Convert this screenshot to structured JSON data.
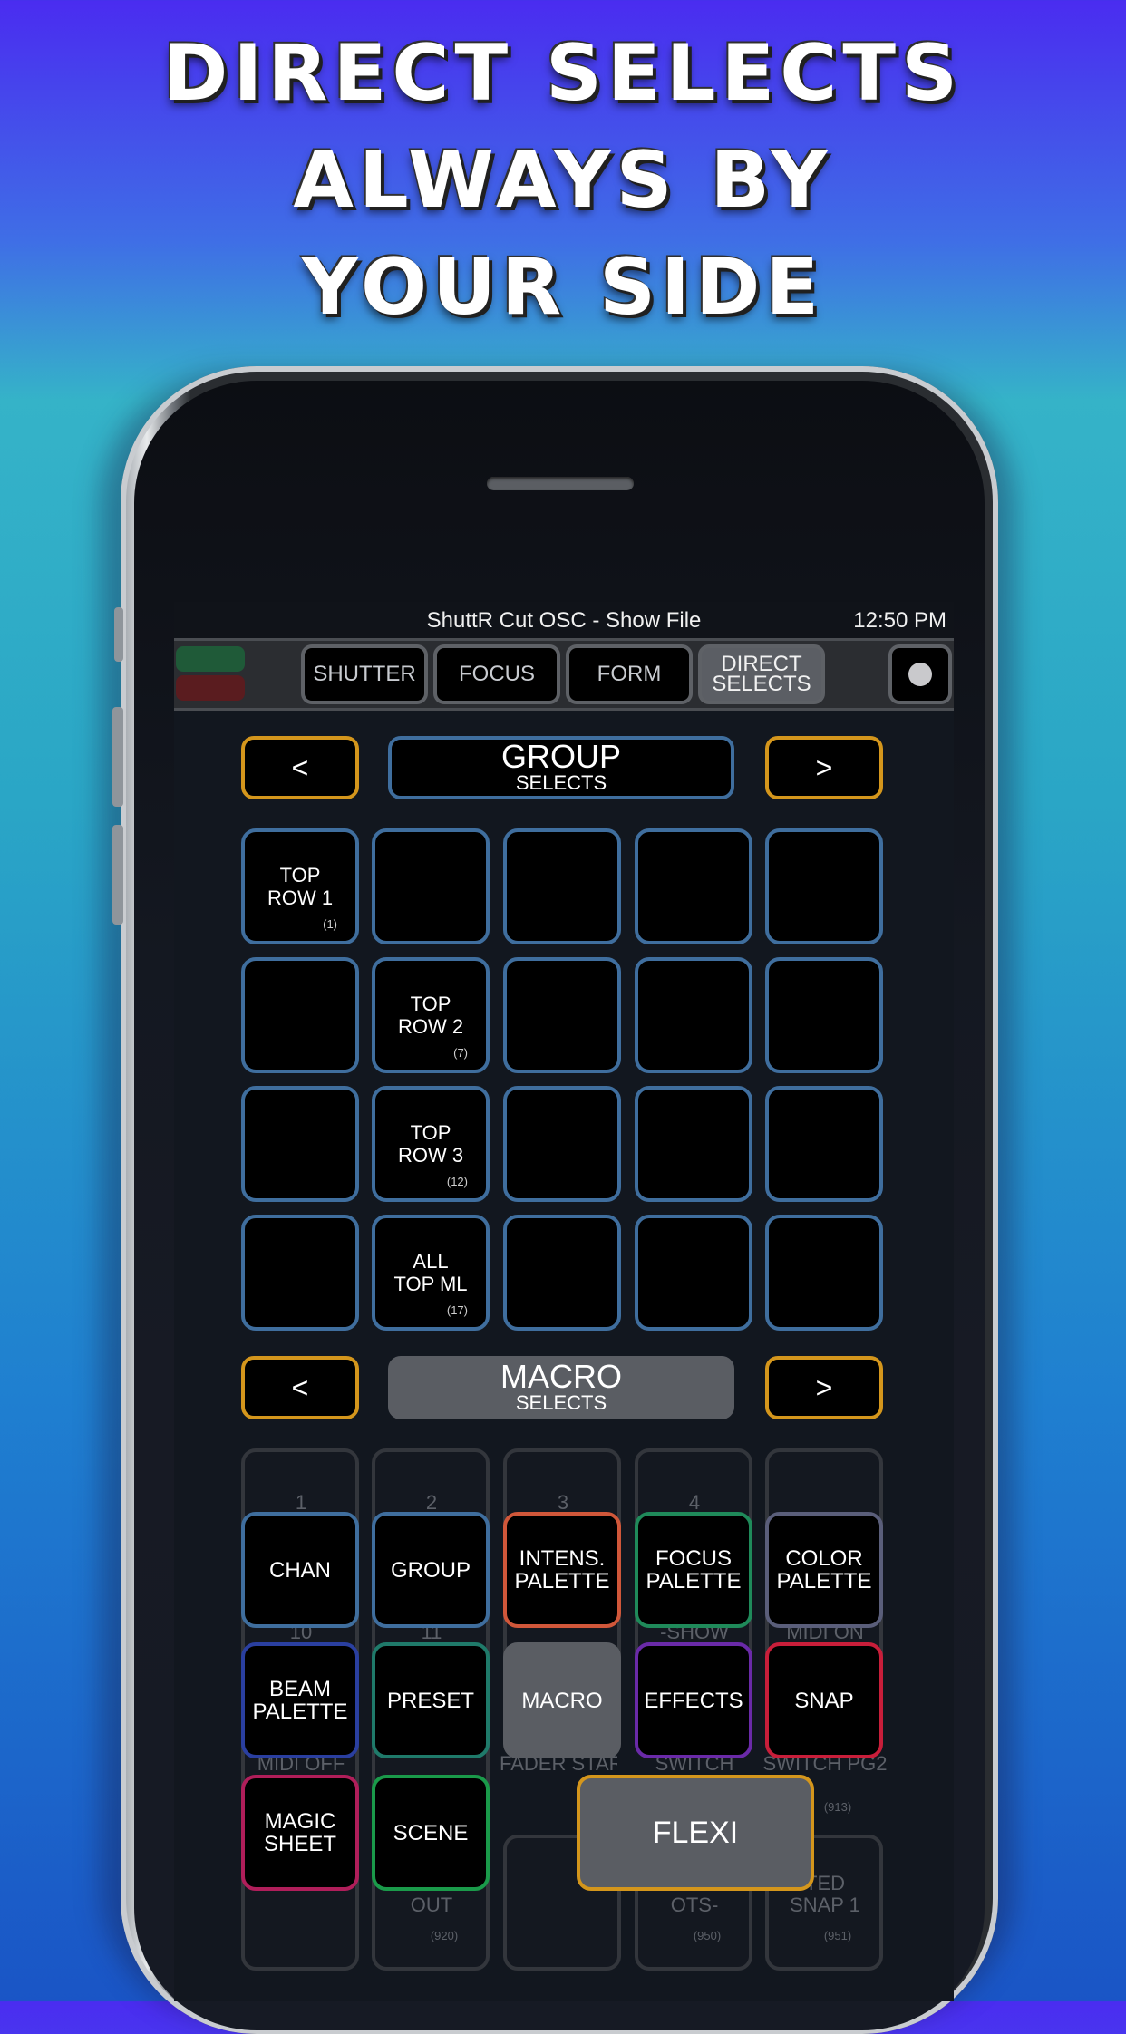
{
  "headline": {
    "line1": "DIRECT SELECTS",
    "line2": "ALWAYS BY",
    "line3": "YOUR SIDE"
  },
  "status_bar": {
    "title": "ShuttR Cut OSC - Show File",
    "time": "12:50 PM"
  },
  "toolbar": {
    "tabs": [
      "SHUTTER",
      "FOCUS",
      "FORM",
      "DIRECT SELECTS"
    ],
    "active_tab": "DIRECT SELECTS",
    "tab4_line1": "DIRECT",
    "tab4_line2": "SELECTS",
    "indicator_colors": {
      "top": "#1f5a38",
      "bottom": "#5a1c1f"
    }
  },
  "group_selects": {
    "prev_label": "<",
    "next_label": ">",
    "title": "GROUP",
    "subtitle": "SELECTS",
    "cells": [
      {
        "line1": "TOP",
        "line2": "ROW 1",
        "num": "(1)"
      },
      {
        "line1": "TOP",
        "line2": "ROW 2",
        "num": "(7)"
      },
      {
        "line1": "TOP",
        "line2": "ROW 3",
        "num": "(12)"
      },
      {
        "line1": "ALL",
        "line2": "TOP ML",
        "num": "(17)"
      }
    ]
  },
  "macro_selects": {
    "prev_label": "<",
    "next_label": ">",
    "title": "MACRO",
    "subtitle": "SELECTS",
    "background_labels": {
      "n1": "1",
      "n2": "2",
      "n3": "3",
      "n4": "4",
      "n10": "10",
      "n11": "11",
      "show": "-SHOW",
      "midi_on": "MIDI ON",
      "midi_off": "MIDI OFF",
      "fader_startup": "FADER STARTUP",
      "switch": "SWITCH",
      "switch_pg2": "SWITCH PG2",
      "num913": "(913)",
      "out": "OUT",
      "num920": "(920)",
      "ots": "OTS-",
      "num950": "(950)",
      "ted": "TED",
      "snap1": "SNAP 1",
      "num951": "(951)"
    }
  },
  "menu": {
    "items": [
      {
        "label": "CHAN",
        "color": "#3f6e9e"
      },
      {
        "label": "GROUP",
        "color": "#3f6e9e"
      },
      {
        "label": "INTENS. PALETTE",
        "color": "#d0573a"
      },
      {
        "label": "FOCUS PALETTE",
        "color": "#1f8a5a"
      },
      {
        "label": "COLOR PALETTE",
        "color": "#5a5e7a"
      },
      {
        "label": "BEAM PALETTE",
        "color": "#2a3fa0"
      },
      {
        "label": "PRESET",
        "color": "#1f7a6a"
      },
      {
        "label": "MACRO",
        "color": "#5a5d63"
      },
      {
        "label": "EFFECTS",
        "color": "#6a2aa8"
      },
      {
        "label": "SNAP",
        "color": "#c81e3a"
      },
      {
        "label": "MAGIC SHEET",
        "color": "#b01e5a"
      },
      {
        "label": "SCENE",
        "color": "#1a9a4a"
      }
    ],
    "flexi_label": "FLEXI",
    "flexi_color": "#d4961c"
  }
}
